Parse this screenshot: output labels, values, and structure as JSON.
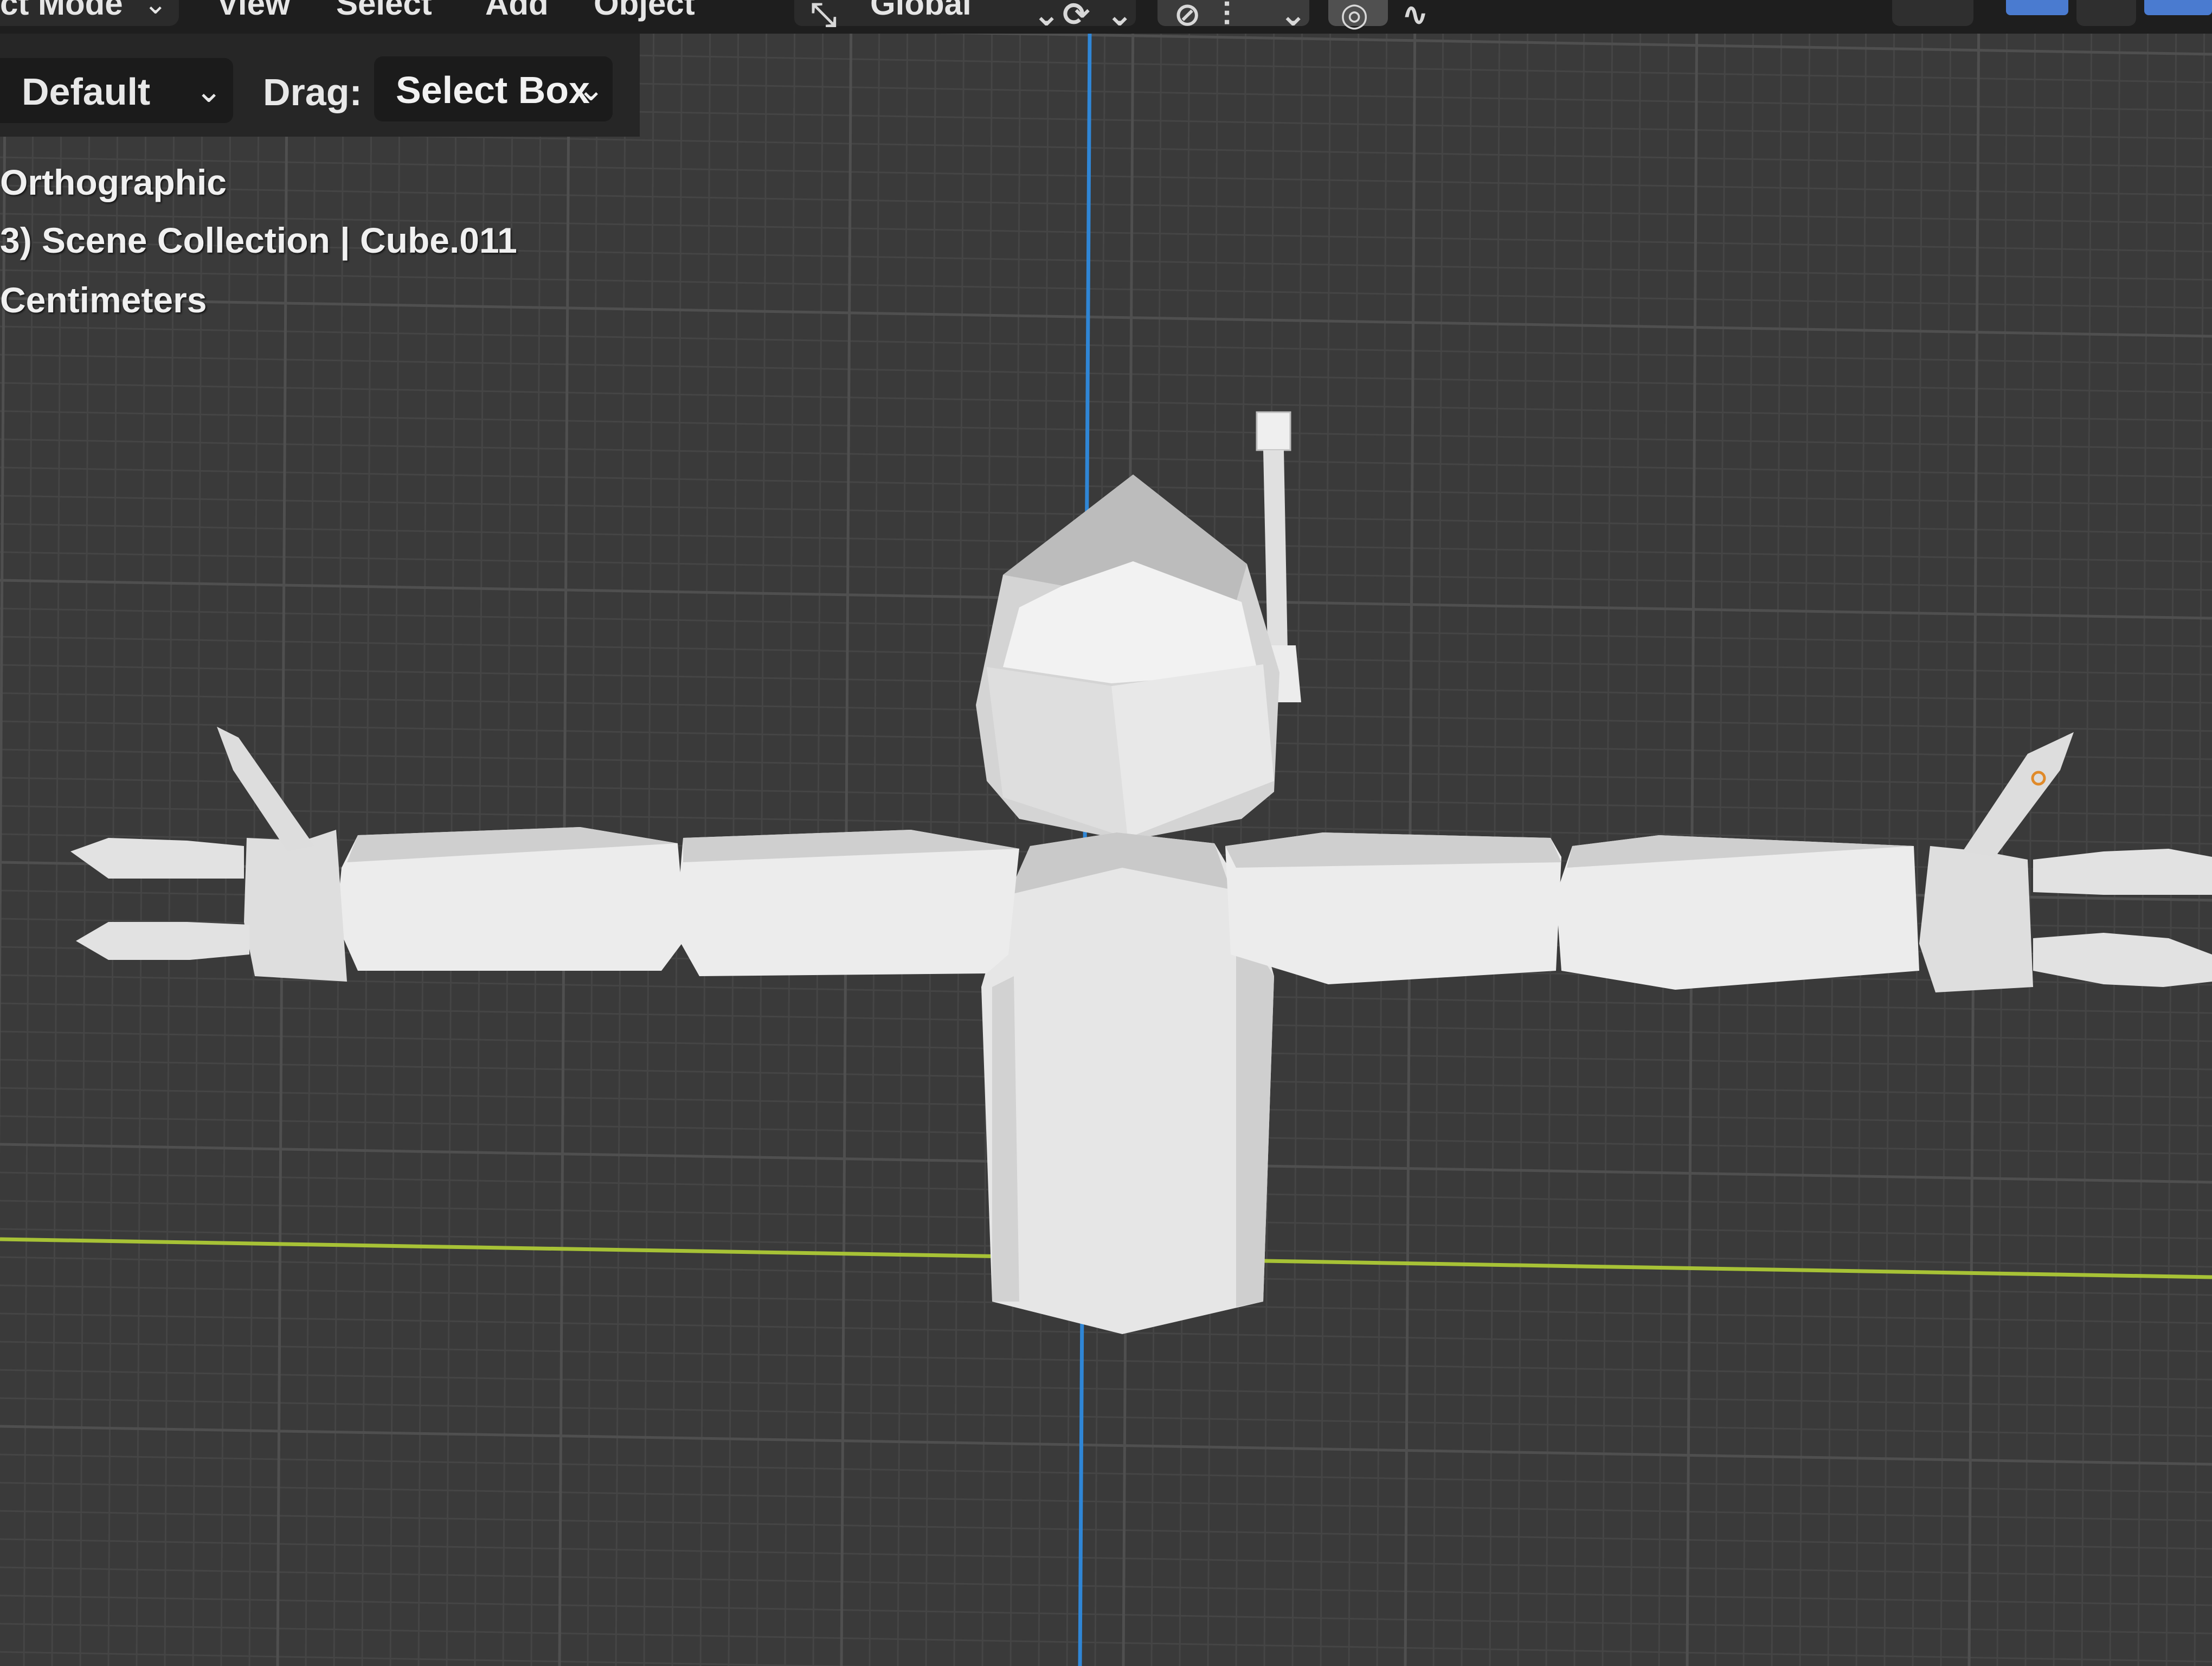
{
  "header": {
    "mode_label": "ct Mode",
    "menu": [
      "View",
      "Select",
      "Add",
      "Object"
    ],
    "transform_orientation": "Global"
  },
  "tool_settings": {
    "orientation_value": "Default",
    "drag_label": "Drag:",
    "drag_value": "Select Box"
  },
  "viewport": {
    "view_name": "Orthographic",
    "collection_path": "3) Scene Collection | Cube.011",
    "units": "Centimeters"
  },
  "colors": {
    "background": "#3a3a3a",
    "grid_minor": "#454545",
    "grid_major": "#4f4f4f",
    "axis_x": "#a7c236",
    "axis_z": "#2f86d6",
    "model": "#e4e4e4",
    "accent_blue": "#4a7bd0"
  },
  "icons": {
    "chevron": "chevron-down-icon",
    "orientation": "transform-orientation-icon",
    "pivot": "pivot-point-icon",
    "snap": "snap-magnet-icon",
    "proportional": "proportional-edit-icon"
  }
}
